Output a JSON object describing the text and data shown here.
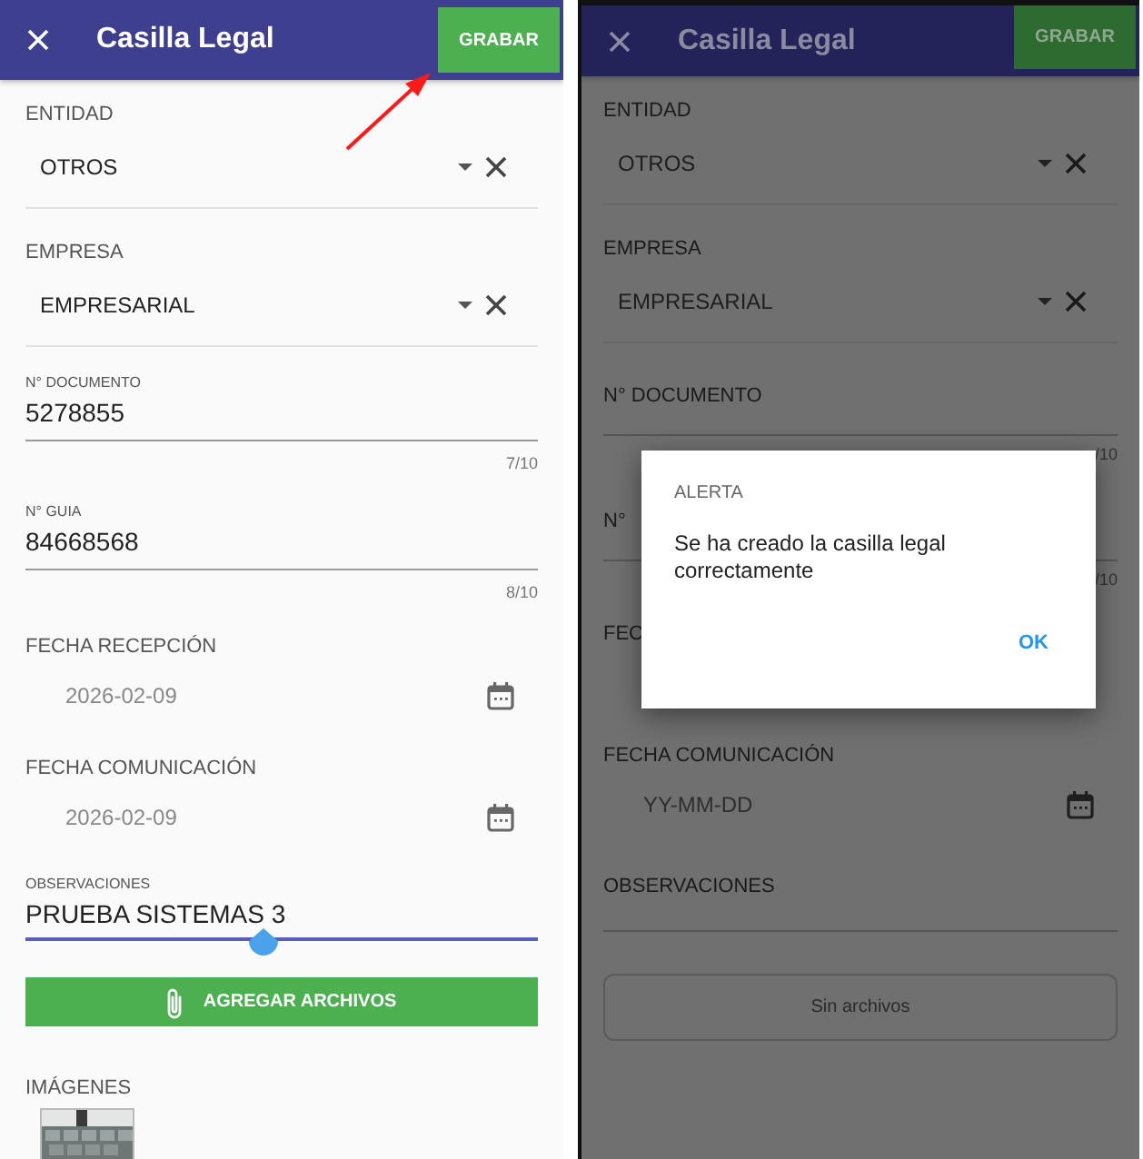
{
  "screens": [
    {
      "dimmed": false,
      "app_bar": {
        "title": "Casilla Legal",
        "action": "GRABAR"
      },
      "fields": [
        {
          "kind": "select",
          "label": "ENTIDAD",
          "value": "OTROS"
        },
        {
          "kind": "select",
          "label": "EMPRESA",
          "value": "EMPRESARIAL"
        },
        {
          "kind": "text",
          "label": "N° DOCUMENTO",
          "value": "5278855",
          "counter": "7/10"
        },
        {
          "kind": "text",
          "label": "N° GUIA",
          "value": "84668568",
          "counter": "8/10"
        },
        {
          "kind": "date",
          "label": "FECHA RECEPCIÓN",
          "value": "2026-02-09",
          "calendar_icon": true
        },
        {
          "kind": "date",
          "label": "FECHA COMUNICACIÓN",
          "value": "2026-02-09",
          "calendar_icon": true
        },
        {
          "kind": "textarea",
          "label": "OBSERVACIONES",
          "value": "PRUEBA SISTEMAS 3",
          "focused": true
        }
      ],
      "attachments": {
        "kind": "button",
        "label": "AGREGAR ARCHIVOS"
      },
      "images": {
        "label": "IMÁGENES"
      }
    },
    {
      "dimmed": true,
      "app_bar": {
        "title": "Casilla Legal",
        "action": "GRABAR"
      },
      "fields": [
        {
          "kind": "select",
          "label": "ENTIDAD",
          "value": "OTROS"
        },
        {
          "kind": "select",
          "label": "EMPRESA",
          "value": "EMPRESARIAL"
        },
        {
          "kind": "text",
          "label": "N° DOCUMENTO",
          "counter": "/10"
        },
        {
          "kind": "text",
          "label": "N°",
          "counter": "/10"
        },
        {
          "kind": "date",
          "label": "FEC",
          "calendar_icon": false
        },
        {
          "kind": "date",
          "label": "FECHA COMUNICACIÓN",
          "placeholder": "YY-MM-DD",
          "calendar_icon": true
        },
        {
          "kind": "textarea",
          "label": "OBSERVACIONES",
          "focused": false
        }
      ],
      "attachments": {
        "kind": "empty",
        "label": "Sin archivos"
      },
      "dialog": {
        "title": "ALERTA",
        "message": "Se ha creado la casilla legal correctamente",
        "button": "OK"
      }
    }
  ]
}
